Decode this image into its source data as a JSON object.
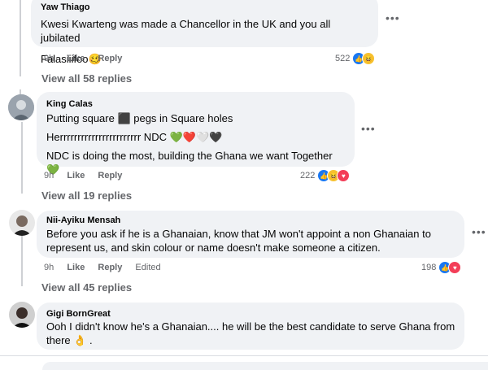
{
  "comments": [
    {
      "author": "Yaw Thiago",
      "lines": [
        "Kwesi Kwarteng was made a Chancellor in the UK and you all jubilated",
        "Falasiiifoo🥴"
      ],
      "time": "9h",
      "like": "Like",
      "reply": "Reply",
      "reaction_count": "522",
      "reactions": [
        "like",
        "haha"
      ],
      "view_all": "View all 58 replies"
    },
    {
      "author": "King Calas",
      "lines": [
        "Putting square ⬛ pegs in Square holes",
        "Herrrrrrrrrrrrrrrrrrrrrrr NDC 💚❤️🤍🖤",
        "NDC is doing the most, building the Ghana we want Together 💚"
      ],
      "time": "9h",
      "like": "Like",
      "reply": "Reply",
      "reaction_count": "222",
      "reactions": [
        "like",
        "haha",
        "love"
      ],
      "view_all": "View all 19 replies"
    },
    {
      "author": "Nii-Ayiku Mensah",
      "lines": [
        "Before you ask if he is a Ghanaian, know that JM won't appoint a non Ghanaian to represent us, and skin colour or name doesn't make someone a citizen."
      ],
      "time": "9h",
      "like": "Like",
      "reply": "Reply",
      "edited": "Edited",
      "reaction_count": "198",
      "reactions": [
        "like",
        "love"
      ],
      "view_all": "View all 45 replies"
    },
    {
      "author": "Gigi BornGreat",
      "lines": [
        "Ooh I didn't know he's a Ghanaian.... he will be the best candidate to serve Ghana from there 👌 ."
      ]
    }
  ],
  "icons": {
    "more": "more-options-icon"
  }
}
